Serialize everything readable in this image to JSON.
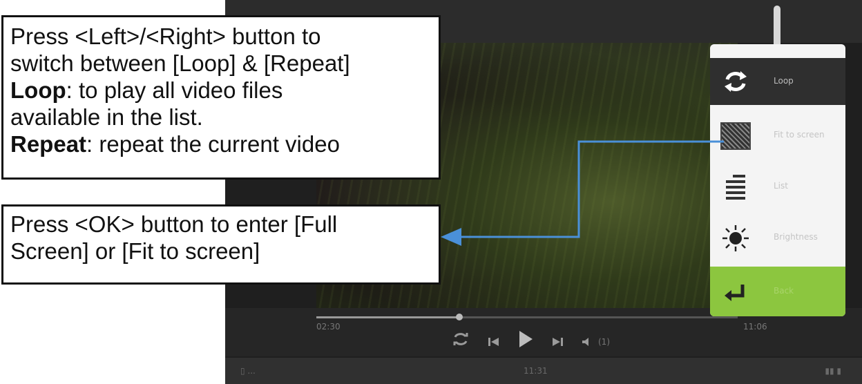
{
  "callouts": {
    "top": {
      "line1_words": [
        "Press",
        "<Left>/<Right>",
        "button",
        "to"
      ],
      "line2": "switch between [Loop] & [Repeat]",
      "line3_term": "Loop",
      "line3_rest_words": [
        ":",
        "to",
        "play",
        "all",
        "video",
        "files"
      ],
      "line4": "available in the list.",
      "line5_term": "Repeat",
      "line5_rest": ": repeat the current video"
    },
    "bottom": {
      "line1": "Press <OK> button to enter [Full",
      "line2": "Screen] or [Fit to screen]"
    }
  },
  "player": {
    "elapsed_time": "02:30",
    "total_time": "11:06",
    "progress_fraction": 0.34,
    "controls": {
      "loop_icon": "loop-icon",
      "prev_icon": "skip-back-icon",
      "play_icon": "play-icon",
      "next_icon": "skip-forward-icon",
      "volume_icon": "volume-icon",
      "volume_value": "(1)"
    }
  },
  "status_bar": {
    "left": "▯ ...",
    "clock": "11:31",
    "right": "▮▮ ▮"
  },
  "side_menu": {
    "items": [
      {
        "label": "Loop",
        "icon": "loop-icon"
      },
      {
        "label": "Fit to screen",
        "icon": "fit-to-screen-icon"
      },
      {
        "label": "List",
        "icon": "list-icon"
      },
      {
        "label": "Brightness",
        "icon": "brightness-icon"
      },
      {
        "label": "Back",
        "icon": "back-arrow-icon"
      }
    ]
  },
  "colors": {
    "menu_highlight": "#2f2f2f",
    "back_button": "#8cc63f",
    "pointer_line": "#4a90d9"
  }
}
